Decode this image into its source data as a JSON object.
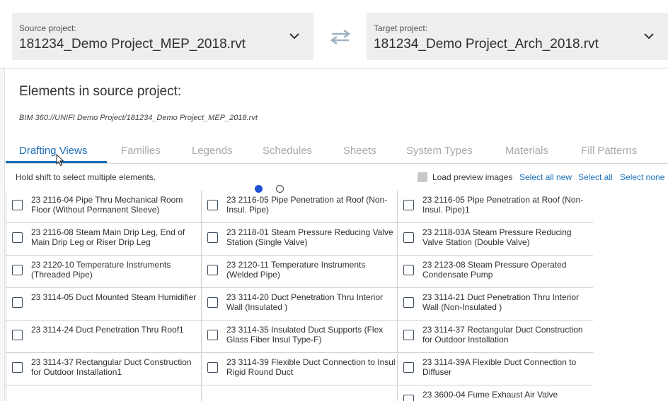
{
  "source": {
    "label": "Source project:",
    "value": "181234_Demo Project_MEP_2018.rvt"
  },
  "target": {
    "label": "Target project:",
    "value": "181234_Demo Project_Arch_2018.rvt"
  },
  "heading": "Elements in source project:",
  "path": "BIM 360://UNIFI Demo Project/181234_Demo Project_MEP_2018.rvt",
  "tabs": [
    "Drafting Views",
    "Families",
    "Legends",
    "Schedules",
    "Sheets",
    "System Types",
    "Materials",
    "Fill Patterns"
  ],
  "toolbar": {
    "hint": "Hold shift to select multiple elements.",
    "load_preview": "Load preview images",
    "select_all_new": "Select all new",
    "select_all": "Select all",
    "select_none": "Select none"
  },
  "items": [
    [
      "23 2116-04 Pipe Thru Mechanical Room Floor (Without Permanent Sleeve)",
      "23 2116-05 Pipe Penetration at Roof (Non-Insul. Pipe)",
      "23 2116-05 Pipe Penetration at Roof (Non-Insul. Pipe)1"
    ],
    [
      "23 2116-08 Steam Main Drip Leg, End of Main Drip Leg or Riser Drip Leg",
      "23 2118-01 Steam Pressure  Reducing Valve Station (Single Valve)",
      "23 2118-03A Steam Pressure  Reducing Valve Station (Double Valve)"
    ],
    [
      "23 2120-10 Temperature Instruments (Threaded Pipe)",
      "23 2120-11 Temperature Instruments (Welded Pipe)",
      "23 2123-08 Steam Pressure Operated Condensate Pump"
    ],
    [
      "23 3114-05 Duct Mounted Steam Humidifier",
      "23 3114-20 Duct Penetration Thru Interior Wall (Insulated  )",
      "23 3114-21 Duct Penetration Thru Interior Wall (Non-Insulated  )"
    ],
    [
      "23 3114-24 Duct Penetration Thru Roof1",
      "23 3114-35 Insulated Duct Supports (Flex Glass Fiber Insul Type-F)",
      "23 3114-37 Rectangular Duct Construction for Outdoor Installation"
    ],
    [
      "23 3114-37 Rectangular Duct Construction for Outdoor Installation1",
      "23 3114-39 Flexible Duct Connection to Insul Rigid Round Duct",
      "23 3114-39A Flexible Duct Connection to Diffuser"
    ],
    [
      "",
      "",
      "23 3600-04 Fume Exhaust Air Valve"
    ]
  ]
}
